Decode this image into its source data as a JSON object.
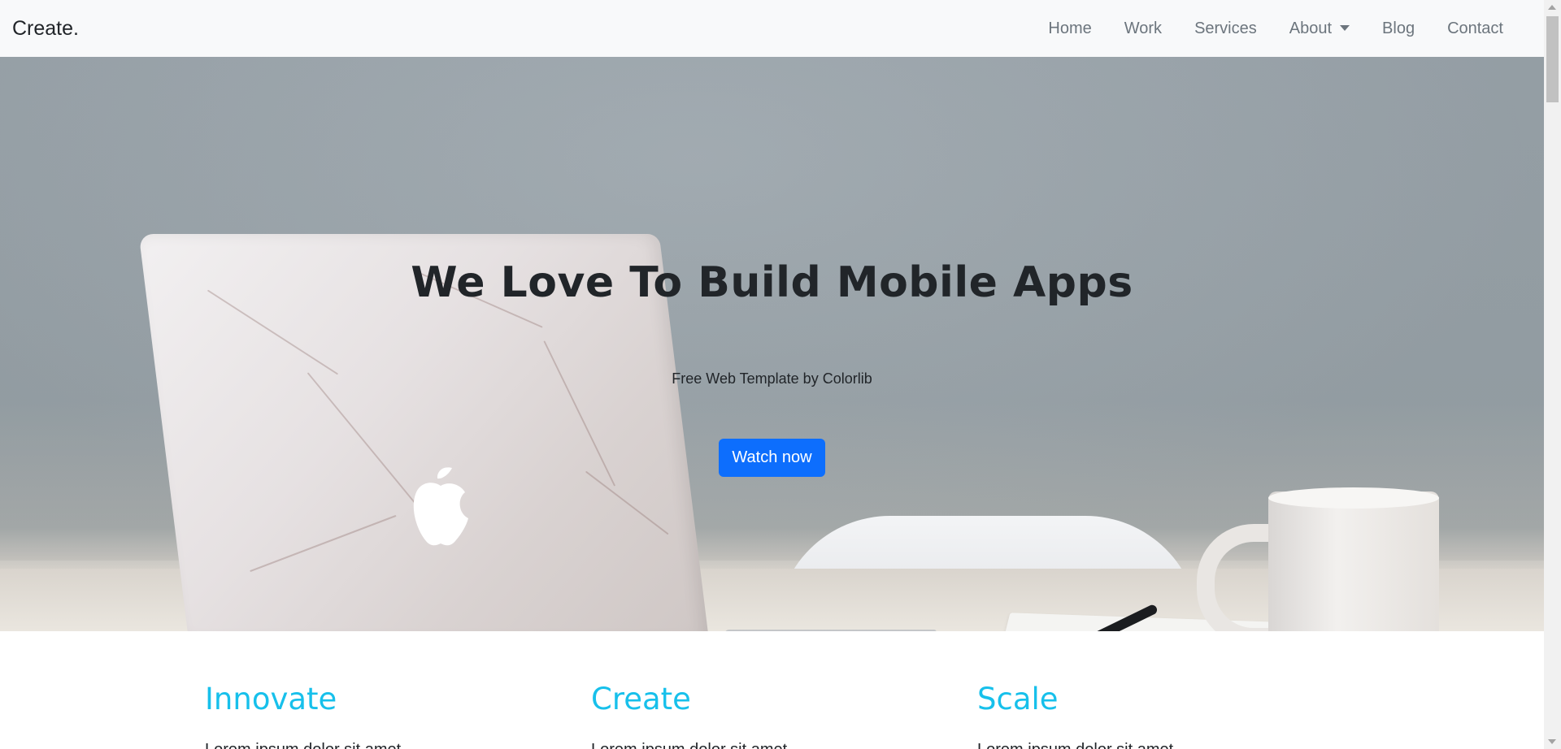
{
  "navbar": {
    "brand": "Create.",
    "items": [
      {
        "label": "Home"
      },
      {
        "label": "Work"
      },
      {
        "label": "Services"
      },
      {
        "label": "About",
        "has_dropdown": true
      },
      {
        "label": "Blog"
      },
      {
        "label": "Contact"
      }
    ]
  },
  "hero": {
    "title": "We Love To Build Mobile Apps",
    "subtitle": "Free Web Template by Colorlib",
    "button_label": "Watch now"
  },
  "features": [
    {
      "title": "Innovate",
      "text": "Lorem ipsum dolor sit amet"
    },
    {
      "title": "Create",
      "text": "Lorem ipsum dolor sit amet"
    },
    {
      "title": "Scale",
      "text": "Lorem ipsum dolor sit amet"
    }
  ],
  "colors": {
    "navbar_bg": "#f8f9fa",
    "nav_link": "#6c757d",
    "primary_button": "#0d6efd",
    "feature_heading": "#17c0eb",
    "hero_text": "#212529"
  }
}
